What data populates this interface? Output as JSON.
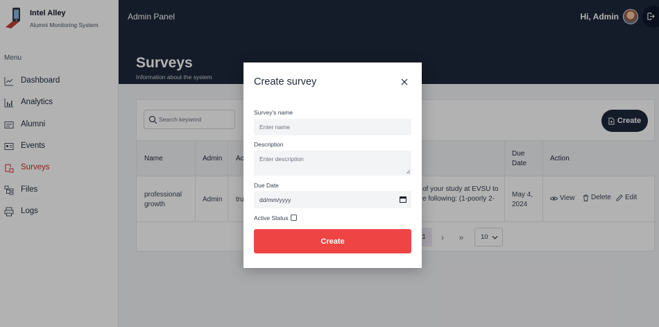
{
  "brand": {
    "name": "Intel Alley",
    "subtitle": "Alumni Monitoring System"
  },
  "sidebar": {
    "menu_label": "Menu",
    "items": [
      {
        "label": "Dashboard",
        "icon": "chart-line-icon",
        "active": false
      },
      {
        "label": "Analytics",
        "icon": "bar-chart-icon",
        "active": false
      },
      {
        "label": "Alumni",
        "icon": "id-card-icon",
        "active": false
      },
      {
        "label": "Events",
        "icon": "newspaper-icon",
        "active": false
      },
      {
        "label": "Surveys",
        "icon": "clipboard-icon",
        "active": true
      },
      {
        "label": "Files",
        "icon": "file-tree-icon",
        "active": false
      },
      {
        "label": "Logs",
        "icon": "printer-icon",
        "active": false
      }
    ]
  },
  "topbar": {
    "title": "Admin Panel",
    "greeting": "Hi, Admin"
  },
  "hero": {
    "title": "Surveys",
    "subtitle": "Information about the system"
  },
  "toolbar": {
    "search_placeholder": "Search keyword",
    "create_label": "Create"
  },
  "table": {
    "headers": {
      "name": "Name",
      "admin": "Admin",
      "active_partial": "Ac",
      "due": "Due Date",
      "action": "Action"
    },
    "rows": [
      {
        "name": "professional growth",
        "admin": "Admin",
        "active_partial": "tru",
        "desc_line1": "of your study at EVSU to",
        "desc_line2": "e following: (1-poorly 2-",
        "due": "May 4, 2024",
        "actions": {
          "view": "View",
          "delete": "Delete",
          "edit": "Edit"
        }
      }
    ]
  },
  "pagination": {
    "current": "1",
    "next": "›",
    "last": "»",
    "per_page": "10"
  },
  "modal": {
    "title": "Create survey",
    "name_label": "Survey's name",
    "name_placeholder": "Enter name",
    "description_label": "Description",
    "description_placeholder": "Enter description",
    "due_label": "Due Date",
    "due_placeholder": "dd/mm/yyyy",
    "active_label": "Active Status",
    "active_checked": false,
    "submit_label": "Create"
  },
  "colors": {
    "sidebar_active": "#dc2626",
    "header_bg": "#1e293b",
    "create_button": "#ef4444",
    "dark_button": "#1e293b"
  }
}
